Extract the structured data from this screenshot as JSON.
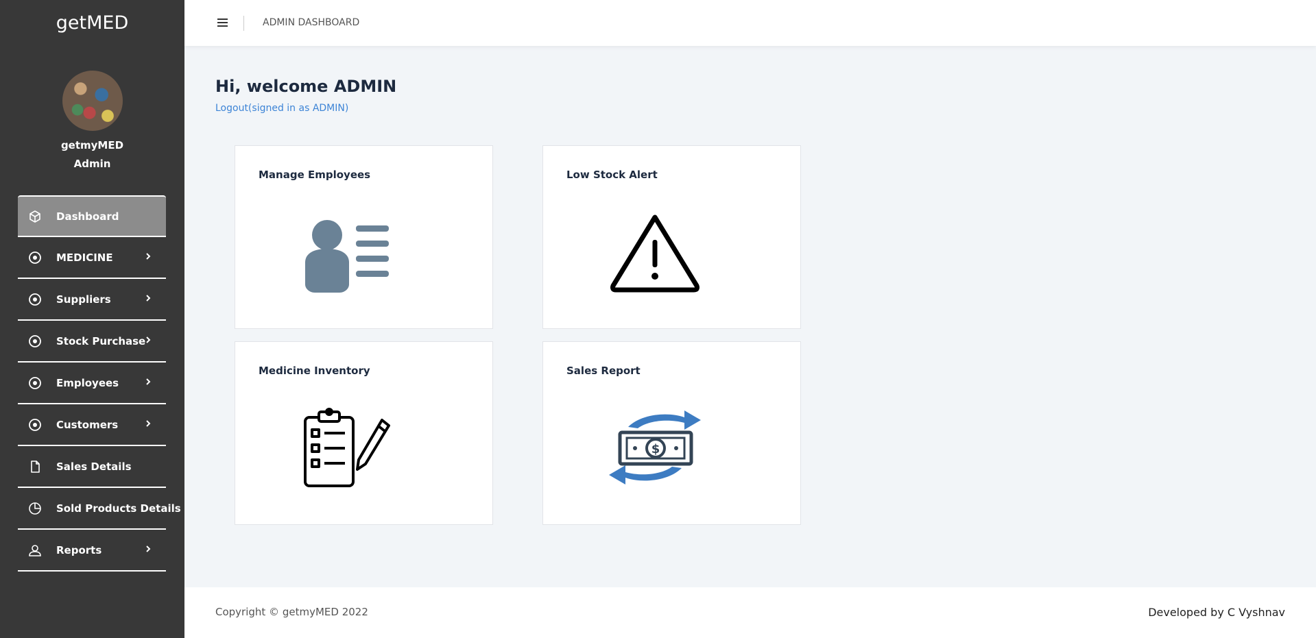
{
  "sidebar": {
    "brand": "getMED",
    "user_name": "getmyMED",
    "user_role": "Admin",
    "items": [
      {
        "label": "Dashboard",
        "icon": "cube-icon",
        "active": true,
        "chevron": false
      },
      {
        "label": "MEDICINE",
        "icon": "circle-dot-icon",
        "chevron": true
      },
      {
        "label": "Suppliers",
        "icon": "circle-dot-icon",
        "chevron": true
      },
      {
        "label": "Stock Purchase",
        "icon": "circle-dot-icon",
        "chevron": true
      },
      {
        "label": "Employees",
        "icon": "circle-dot-icon",
        "chevron": true
      },
      {
        "label": "Customers",
        "icon": "circle-dot-icon",
        "chevron": true
      },
      {
        "label": "Sales Details",
        "icon": "file-icon",
        "chevron": false
      },
      {
        "label": "Sold Products Details",
        "icon": "pie-chart-icon",
        "chevron": false
      },
      {
        "label": "Reports",
        "icon": "user-icon",
        "chevron": true
      }
    ]
  },
  "header": {
    "title": "ADMIN DASHBOARD"
  },
  "main": {
    "welcome": "Hi, welcome ADMIN",
    "logout": "Logout(signed in as ADMIN)",
    "cards": [
      {
        "title": "Manage Employees",
        "icon": "employee-id-icon"
      },
      {
        "title": "Low Stock Alert",
        "icon": "warning-triangle-icon"
      },
      {
        "title": "Medicine Inventory",
        "icon": "clipboard-checklist-icon"
      },
      {
        "title": "Sales Report",
        "icon": "money-exchange-icon"
      }
    ]
  },
  "footer": {
    "copyright": "Copyright © getmyMED 2022",
    "developer": "Developed by C Vyshnav"
  },
  "colors": {
    "sidebar_bg": "#383838",
    "active_item_bg": "#8c8c8c",
    "link": "#3d84d6",
    "content_bg": "#f2f5f8"
  }
}
